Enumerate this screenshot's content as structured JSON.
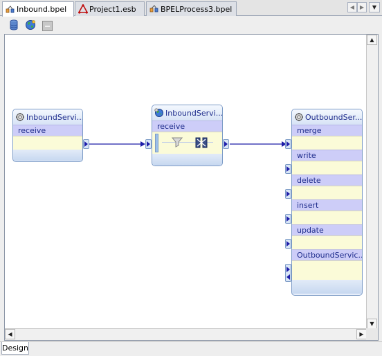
{
  "tabs": [
    {
      "label": "Inbound.bpel",
      "icon": "bpel-process-icon",
      "active": true
    },
    {
      "label": "Project1.esb",
      "icon": "esb-project-icon",
      "active": false
    },
    {
      "label": "BPELProcess3.bpel",
      "icon": "bpel-process-icon",
      "active": false
    }
  ],
  "toolbar": {
    "icons": [
      "database-icon",
      "globe-icon",
      "disabled-button-icon"
    ]
  },
  "nodes": {
    "inbound_service": {
      "title": "InboundServi...",
      "operations": [
        "receive"
      ]
    },
    "routing_service": {
      "title": "InboundServi...",
      "operations": [
        "receive"
      ]
    },
    "outbound_service": {
      "title": "OutboundSer...",
      "operations": [
        "merge",
        "write",
        "delete",
        "insert",
        "update",
        "OutboundServic..."
      ]
    }
  },
  "colors": {
    "connector": "#1c1ca8",
    "node_border": "#7c9bc6",
    "operation_header": "#cdcdf8",
    "operation_body": "#fbfbd8"
  },
  "bottom_tabs": {
    "design": "Design"
  }
}
